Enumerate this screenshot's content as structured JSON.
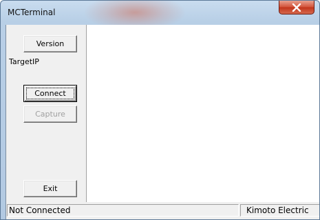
{
  "window": {
    "title": "MCTerminal",
    "close_glyph": "close-icon"
  },
  "panel": {
    "version_label": "Version",
    "target_ip_label": "TargetIP",
    "connect_label": "Connect",
    "capture_label": "Capture",
    "exit_label": "Exit"
  },
  "statusbar": {
    "connection_status": "Not Connected",
    "company": "Kimoto Electric"
  }
}
